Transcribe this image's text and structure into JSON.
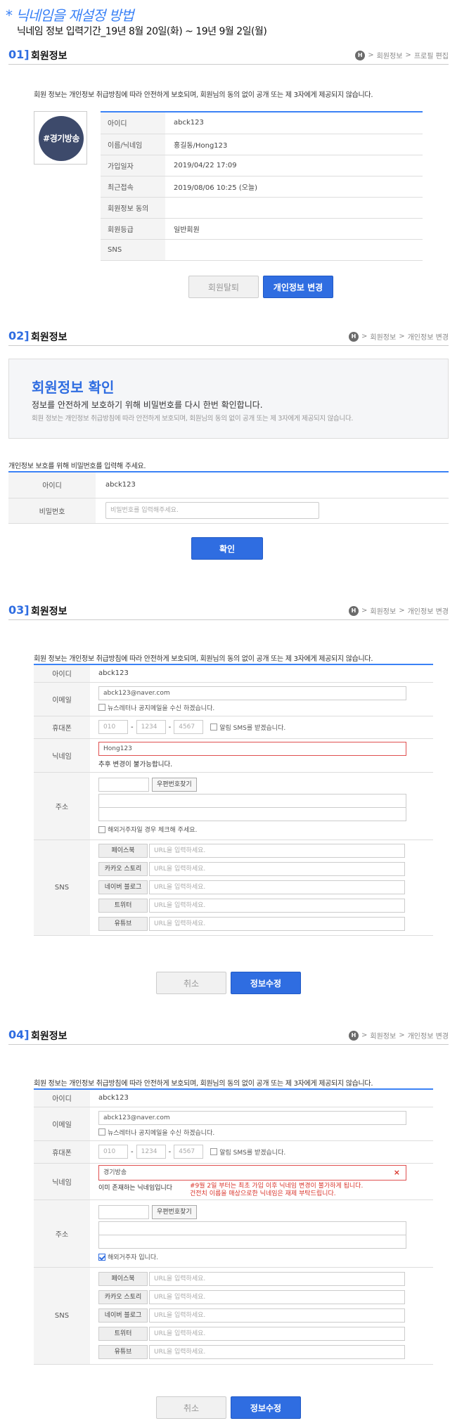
{
  "notice": {
    "title": "* 닉네임을 재설정 방법",
    "subtitle": "닉네임 정보 입력기간_19년 8월 20일(화) ~ 19년 9월 2일(월)"
  },
  "breadcrumb": {
    "home_icon": "H",
    "sep": ">",
    "member_info": "회원정보",
    "profile_edit": "프로필 편집",
    "personal_info_edit": "개인정보 변경"
  },
  "section1": {
    "num": "01]",
    "title": "회원정보",
    "desc": "회원 정보는 개인정보 취급방침에 따라 안전하게 보호되며, 회원님의 동의 없이 공개 또는 제 3자에게 제공되지 않습니다.",
    "avatar_text": "#경기방송",
    "rows": [
      {
        "label": "아이디",
        "value": "abck123"
      },
      {
        "label": "이름/닉네임",
        "value": "홍길동/Hong123"
      },
      {
        "label": "가입일자",
        "value": "2019/04/22 17:09"
      },
      {
        "label": "최근접속",
        "value": "2019/08/06 10:25 (오늘)"
      },
      {
        "label": "회원정보 동의",
        "value": ""
      },
      {
        "label": "회원등급",
        "value": "일반회원"
      },
      {
        "label": "SNS",
        "value": ""
      }
    ],
    "withdraw_button": "회원탈퇴",
    "change_button": "개인정보 변경"
  },
  "section2": {
    "num": "02]",
    "title": "회원정보",
    "box_title": "회원정보 확인",
    "box_line1": "정보를 안전하게 보호하기 위해 비밀번호를 다시 한번 확인합니다.",
    "box_line2": "회원 정보는 개인정보 취급방침에 따라 안전하게 보호되며, 회원님의 동의 없이 공개 또는 제 3자에게 제공되지 않습니다.",
    "prompt": "개인정보 보호를 위해 비밀번호를 입력해 주세요.",
    "id_label": "아이디",
    "id_value": "abck123",
    "pw_label": "비밀번호",
    "pw_placeholder": "비밀번호를 입력해주세요.",
    "confirm_button": "확인"
  },
  "form": {
    "desc": "회원 정보는 개인정보 취급방침에 따라 안전하게 보호되며, 회원님의 동의 없이 공개 또는 제 3자에게 제공되지 않습니다.",
    "id_label": "아이디",
    "id_value": "abck123",
    "email_label": "이메일",
    "newsletter": "뉴스레터나 공지메일을 수신 하겠습니다.",
    "phone_label": "휴대폰",
    "phone1": "010",
    "phone2": "1234",
    "phone3": "4567",
    "dash": "-",
    "sms": "알림 SMS를 받겠습니다.",
    "nick_label": "닉네임",
    "addr_label": "주소",
    "zip_button": "우편번호찾기",
    "sns_label": "SNS",
    "sns_items": [
      "페이스북",
      "카카오 스토리",
      "네이버 블로그",
      "트위터",
      "유튜브"
    ],
    "sns_placeholder": "URL을 입력하세요.",
    "cancel_button": "취소",
    "submit_button": "정보수정"
  },
  "section3": {
    "num": "03]",
    "title": "회원정보",
    "email_value": "abck123@naver.com",
    "nick_value": "Hong123",
    "nick_note": "추후 변경이 불가능합니다.",
    "overseas": "해외거주자일 경우 체크해 주세요."
  },
  "section4": {
    "num": "04]",
    "title": "회원정보",
    "email_value": "abck123@naver.com",
    "nick_value": "경기방송",
    "clear_icon": "×",
    "nick_dup": "이미 존재하는 닉네임입니다",
    "nick_warn1": "#9월 2일 부터는 최초 가입 이후 닉네임 변경이 불가하게 됩니다.",
    "nick_warn2": "건전치 이름을 매상으로한 닉네임은 재제 부탁드립니다.",
    "overseas": "해외거주자 입니다."
  }
}
